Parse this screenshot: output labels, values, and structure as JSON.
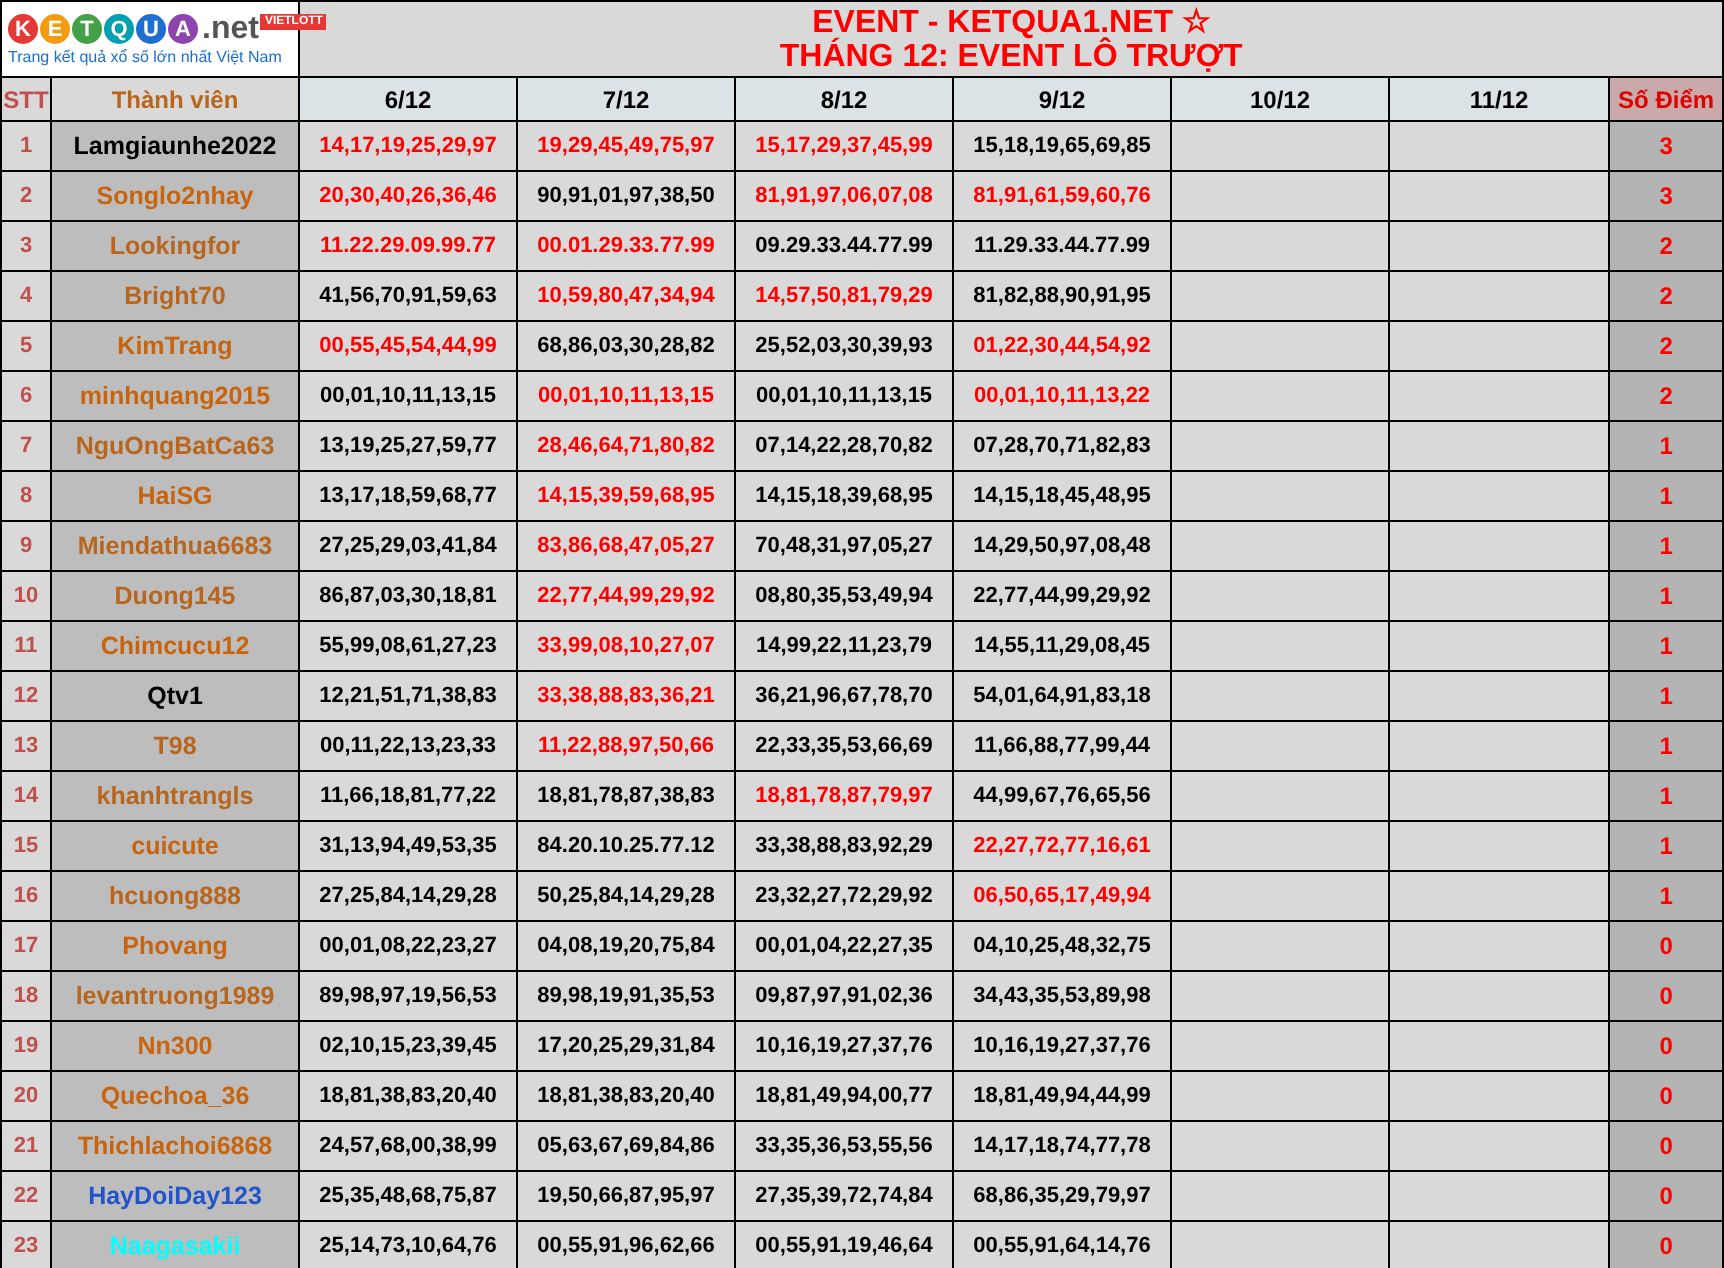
{
  "logo": {
    "letters": [
      {
        "text": "K",
        "color": "#e53935"
      },
      {
        "text": "E",
        "color": "#f39c12"
      },
      {
        "text": "T",
        "color": "#43a047"
      },
      {
        "text": "Q",
        "color": "#00a0b0"
      },
      {
        "text": "U",
        "color": "#1e6fd0"
      },
      {
        "text": "A",
        "color": "#8e44ad"
      }
    ],
    "suffix": ".net",
    "badge": "VIETLOTT",
    "tagline": "Trang kết quả xổ số lớn nhất Việt Nam"
  },
  "title": [
    "EVENT - KETQUA1.NET ☆",
    "THÁNG 12: EVENT LÔ TRƯỢT"
  ],
  "columns": {
    "index": "STT",
    "member": "Thành viên",
    "dates": [
      "6/12",
      "7/12",
      "8/12",
      "9/12",
      "10/12",
      "11/12"
    ],
    "score": "Số Điểm"
  },
  "rows": [
    {
      "stt": "1",
      "name": "Lamgiaunhe2022",
      "color": "#000000",
      "score": "3",
      "picks": [
        {
          "text": "14,17,19,25,29,97",
          "hit": true
        },
        {
          "text": "19,29,45,49,75,97",
          "hit": true
        },
        {
          "text": "15,17,29,37,45,99",
          "hit": true
        },
        {
          "text": "15,18,19,65,69,85",
          "hit": false
        }
      ]
    },
    {
      "stt": "2",
      "name": "Songlo2nhay",
      "color": "#c8640e",
      "score": "3",
      "picks": [
        {
          "text": "20,30,40,26,36,46",
          "hit": true
        },
        {
          "text": "90,91,01,97,38,50",
          "hit": false
        },
        {
          "text": "81,91,97,06,07,08",
          "hit": true
        },
        {
          "text": "81,91,61,59,60,76",
          "hit": true
        }
      ]
    },
    {
      "stt": "3",
      "name": "Lookingfor",
      "color": "#b8651e",
      "score": "2",
      "picks": [
        {
          "text": "11.22.29.09.99.77",
          "hit": true
        },
        {
          "text": "00.01.29.33.77.99",
          "hit": true
        },
        {
          "text": "09.29.33.44.77.99",
          "hit": false
        },
        {
          "text": "11.29.33.44.77.99",
          "hit": false
        }
      ]
    },
    {
      "stt": "4",
      "name": "Bright70",
      "color": "#b8651e",
      "score": "2",
      "picks": [
        {
          "text": "41,56,70,91,59,63",
          "hit": false
        },
        {
          "text": "10,59,80,47,34,94",
          "hit": true
        },
        {
          "text": "14,57,50,81,79,29",
          "hit": true
        },
        {
          "text": "81,82,88,90,91,95",
          "hit": false
        }
      ]
    },
    {
      "stt": "5",
      "name": "KimTrang",
      "color": "#c8640e",
      "score": "2",
      "picks": [
        {
          "text": "00,55,45,54,44,99",
          "hit": true
        },
        {
          "text": "68,86,03,30,28,82",
          "hit": false
        },
        {
          "text": "25,52,03,30,39,93",
          "hit": false
        },
        {
          "text": "01,22,30,44,54,92",
          "hit": true
        }
      ]
    },
    {
      "stt": "6",
      "name": "minhquang2015",
      "color": "#c8640e",
      "score": "2",
      "picks": [
        {
          "text": "00,01,10,11,13,15",
          "hit": false
        },
        {
          "text": "00,01,10,11,13,15",
          "hit": true
        },
        {
          "text": "00,01,10,11,13,15",
          "hit": false
        },
        {
          "text": "00,01,10,11,13,22",
          "hit": true
        }
      ]
    },
    {
      "stt": "7",
      "name": "NguOngBatCa63",
      "color": "#b8651e",
      "score": "1",
      "picks": [
        {
          "text": "13,19,25,27,59,77",
          "hit": false
        },
        {
          "text": "28,46,64,71,80,82",
          "hit": true
        },
        {
          "text": "07,14,22,28,70,82",
          "hit": false
        },
        {
          "text": "07,28,70,71,82,83",
          "hit": false
        }
      ]
    },
    {
      "stt": "8",
      "name": "HaiSG",
      "color": "#c8640e",
      "score": "1",
      "picks": [
        {
          "text": "13,17,18,59,68,77",
          "hit": false
        },
        {
          "text": "14,15,39,59,68,95",
          "hit": true
        },
        {
          "text": "14,15,18,39,68,95",
          "hit": false
        },
        {
          "text": "14,15,18,45,48,95",
          "hit": false
        }
      ]
    },
    {
      "stt": "9",
      "name": "Miendathua6683",
      "color": "#b8651e",
      "score": "1",
      "picks": [
        {
          "text": "27,25,29,03,41,84",
          "hit": false
        },
        {
          "text": "83,86,68,47,05,27",
          "hit": true
        },
        {
          "text": "70,48,31,97,05,27",
          "hit": false
        },
        {
          "text": "14,29,50,97,08,48",
          "hit": false
        }
      ]
    },
    {
      "stt": "10",
      "name": "Duong145",
      "color": "#b8651e",
      "score": "1",
      "picks": [
        {
          "text": "86,87,03,30,18,81",
          "hit": false
        },
        {
          "text": "22,77,44,99,29,92",
          "hit": true
        },
        {
          "text": "08,80,35,53,49,94",
          "hit": false
        },
        {
          "text": "22,77,44,99,29,92",
          "hit": false
        }
      ]
    },
    {
      "stt": "11",
      "name": "Chimcucu12",
      "color": "#c8640e",
      "score": "1",
      "picks": [
        {
          "text": "55,99,08,61,27,23",
          "hit": false
        },
        {
          "text": "33,99,08,10,27,07",
          "hit": true
        },
        {
          "text": "14,99,22,11,23,79",
          "hit": false
        },
        {
          "text": "14,55,11,29,08,45",
          "hit": false
        }
      ]
    },
    {
      "stt": "12",
      "name": "Qtv1",
      "color": "#000000",
      "score": "1",
      "picks": [
        {
          "text": "12,21,51,71,38,83",
          "hit": false
        },
        {
          "text": "33,38,88,83,36,21",
          "hit": true
        },
        {
          "text": "36,21,96,67,78,70",
          "hit": false
        },
        {
          "text": "54,01,64,91,83,18",
          "hit": false
        }
      ]
    },
    {
      "stt": "13",
      "name": "T98",
      "color": "#b8651e",
      "score": "1",
      "picks": [
        {
          "text": "00,11,22,13,23,33",
          "hit": false
        },
        {
          "text": "11,22,88,97,50,66",
          "hit": true
        },
        {
          "text": "22,33,35,53,66,69",
          "hit": false
        },
        {
          "text": "11,66,88,77,99,44",
          "hit": false
        }
      ]
    },
    {
      "stt": "14",
      "name": "khanhtrangls",
      "color": "#b8651e",
      "score": "1",
      "picks": [
        {
          "text": "11,66,18,81,77,22",
          "hit": false
        },
        {
          "text": "18,81,78,87,38,83",
          "hit": false
        },
        {
          "text": "18,81,78,87,79,97",
          "hit": true
        },
        {
          "text": "44,99,67,76,65,56",
          "hit": false
        }
      ]
    },
    {
      "stt": "15",
      "name": "cuicute",
      "color": "#c8640e",
      "score": "1",
      "picks": [
        {
          "text": "31,13,94,49,53,35",
          "hit": false
        },
        {
          "text": "84.20.10.25.77.12",
          "hit": false
        },
        {
          "text": "33,38,88,83,92,29",
          "hit": false
        },
        {
          "text": "22,27,72,77,16,61",
          "hit": true
        }
      ]
    },
    {
      "stt": "16",
      "name": "hcuong888",
      "color": "#b8651e",
      "score": "1",
      "picks": [
        {
          "text": "27,25,84,14,29,28",
          "hit": false
        },
        {
          "text": "50,25,84,14,29,28",
          "hit": false
        },
        {
          "text": "23,32,27,72,29,92",
          "hit": false
        },
        {
          "text": "06,50,65,17,49,94",
          "hit": true
        }
      ]
    },
    {
      "stt": "17",
      "name": "Phovang",
      "color": "#c8640e",
      "score": "0",
      "picks": [
        {
          "text": "00,01,08,22,23,27",
          "hit": false
        },
        {
          "text": "04,08,19,20,75,84",
          "hit": false
        },
        {
          "text": "00,01,04,22,27,35",
          "hit": false
        },
        {
          "text": "04,10,25,48,32,75",
          "hit": false
        }
      ]
    },
    {
      "stt": "18",
      "name": "levantruong1989",
      "color": "#b8651e",
      "score": "0",
      "picks": [
        {
          "text": "89,98,97,19,56,53",
          "hit": false
        },
        {
          "text": "89,98,19,91,35,53",
          "hit": false
        },
        {
          "text": "09,87,97,91,02,36",
          "hit": false
        },
        {
          "text": "34,43,35,53,89,98",
          "hit": false
        }
      ]
    },
    {
      "stt": "19",
      "name": "Nn300",
      "color": "#c8640e",
      "score": "0",
      "picks": [
        {
          "text": "02,10,15,23,39,45",
          "hit": false
        },
        {
          "text": "17,20,25,29,31,84",
          "hit": false
        },
        {
          "text": "10,16,19,27,37,76",
          "hit": false
        },
        {
          "text": "10,16,19,27,37,76",
          "hit": false
        }
      ]
    },
    {
      "stt": "20",
      "name": "Quechoa_36",
      "color": "#c8640e",
      "score": "0",
      "picks": [
        {
          "text": "18,81,38,83,20,40",
          "hit": false
        },
        {
          "text": "18,81,38,83,20,40",
          "hit": false
        },
        {
          "text": "18,81,49,94,00,77",
          "hit": false
        },
        {
          "text": "18,81,49,94,44,99",
          "hit": false
        }
      ]
    },
    {
      "stt": "21",
      "name": "Thichlachoi6868",
      "color": "#c8640e",
      "score": "0",
      "picks": [
        {
          "text": "24,57,68,00,38,99",
          "hit": false
        },
        {
          "text": "05,63,67,69,84,86",
          "hit": false
        },
        {
          "text": "33,35,36,53,55,56",
          "hit": false
        },
        {
          "text": "14,17,18,74,77,78",
          "hit": false
        }
      ]
    },
    {
      "stt": "22",
      "name": "HayDoiDay123",
      "color": "#2255cc",
      "score": "0",
      "picks": [
        {
          "text": "25,35,48,68,75,87",
          "hit": false
        },
        {
          "text": "19,50,66,87,95,97",
          "hit": false
        },
        {
          "text": "27,35,39,72,74,84",
          "hit": false
        },
        {
          "text": "68,86,35,29,79,97",
          "hit": false
        }
      ]
    },
    {
      "stt": "23",
      "name": "Naagasakii",
      "color": "#00ffff",
      "score": "0",
      "picks": [
        {
          "text": "25,14,73,10,64,76",
          "hit": false
        },
        {
          "text": "00,55,91,96,62,66",
          "hit": false
        },
        {
          "text": "00,55,91,19,46,64",
          "hit": false
        },
        {
          "text": "00,55,91,64,14,76",
          "hit": false
        }
      ]
    }
  ]
}
